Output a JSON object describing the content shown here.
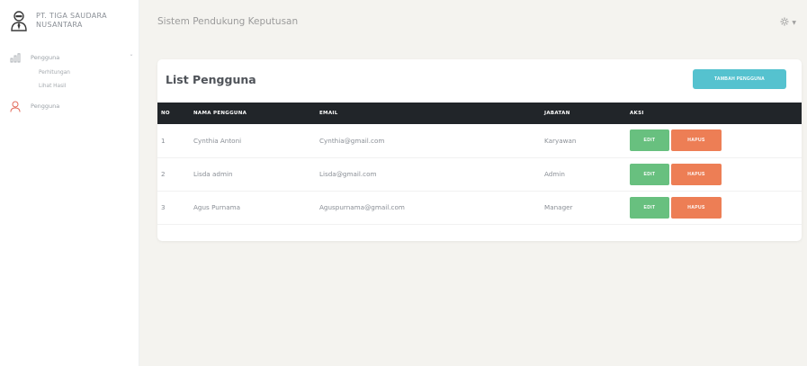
{
  "sidebar": {
    "brand_line1": "PT. TIGA SAUDARA",
    "brand_line2": "NUSANTARA",
    "menu": [
      {
        "label": "Pengguna",
        "icon": "chart-icon"
      },
      {
        "label": "Pengguna",
        "icon": "user-icon"
      }
    ],
    "submenu": [
      {
        "label": "Perhitungan"
      },
      {
        "label": "Lihat Hasil"
      }
    ]
  },
  "header": {
    "app_title": "Sistem Pendukung Keputusan",
    "settings_icon": "gear-icon"
  },
  "main": {
    "card_title": "List Pengguna",
    "add_button": "TAMBAH PENGGUNA",
    "columns": [
      "NO",
      "NAMA PENGGUNA",
      "EMAIL",
      "JABATAN",
      "AKSI"
    ],
    "rows": [
      {
        "no": "1",
        "name": "Cynthia Antoni",
        "email": "Cynthia@gmail.com",
        "jabatan": "Karyawan"
      },
      {
        "no": "2",
        "name": "Lisda admin",
        "email": "Lisda@gmail.com",
        "jabatan": "Admin"
      },
      {
        "no": "3",
        "name": "Agus Purnama",
        "email": "Aguspurnama@gmail.com",
        "jabatan": "Manager"
      }
    ],
    "edit_label": "EDIT",
    "delete_label": "HAPUS"
  },
  "colors": {
    "accent": "#55c2cf",
    "edit": "#68c07f",
    "delete": "#ed7e55",
    "table_header": "#212529"
  }
}
